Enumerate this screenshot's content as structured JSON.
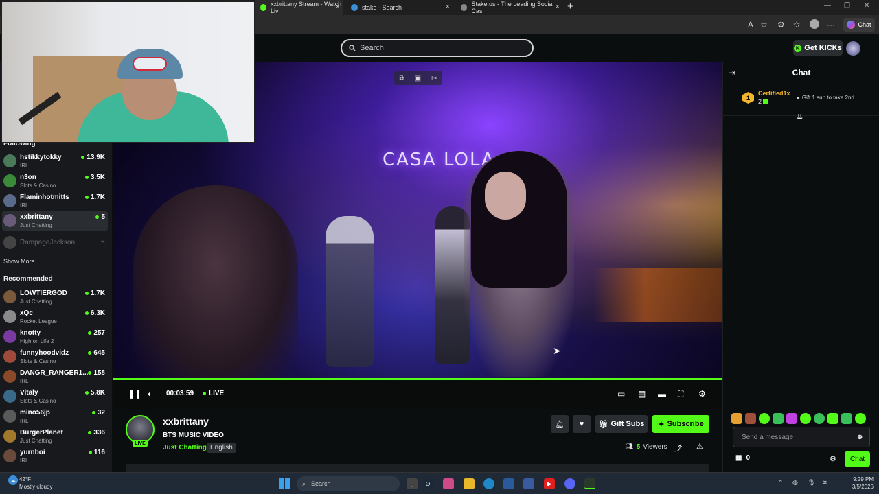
{
  "browser": {
    "tabs": [
      {
        "label": "xxbrittany Stream - Watch Liv"
      },
      {
        "label": "stake - Search"
      },
      {
        "label": "Stake.us - The Leading Social Casi"
      }
    ],
    "chat_button": "Chat"
  },
  "header": {
    "search_placeholder": "Search",
    "get_kicks": "Get KICKs"
  },
  "sidebar": {
    "following_heading": "Following",
    "following": [
      {
        "name": "hstikkytokky",
        "category": "IRL",
        "viewers": "13.9K",
        "color": "#4a7a5a"
      },
      {
        "name": "n3on",
        "category": "Slots & Casino",
        "viewers": "3.5K",
        "color": "#3a8a3a"
      },
      {
        "name": "Flaminhotmitts",
        "category": "IRL",
        "viewers": "1.7K",
        "color": "#5a6a8a"
      },
      {
        "name": "xxbrittany",
        "category": "Just Chatting",
        "viewers": "5",
        "color": "#6a5a7a"
      }
    ],
    "offline": {
      "name": "RampageJackson"
    },
    "show_more": "Show More",
    "recommended_heading": "Recommended",
    "recommended": [
      {
        "name": "LOWTIERGOD",
        "category": "Just Chatting",
        "viewers": "1.7K",
        "color": "#7a5a3a"
      },
      {
        "name": "xQc",
        "category": "Rocket League",
        "viewers": "6.3K",
        "color": "#8a8a8a"
      },
      {
        "name": "knotty",
        "category": "High on Life 2",
        "viewers": "257",
        "color": "#7a3aa0"
      },
      {
        "name": "funnyhoodvidz",
        "category": "Slots & Casino",
        "viewers": "645",
        "color": "#a04a3a"
      },
      {
        "name": "DANGR_RANGER1...",
        "category": "IRL",
        "viewers": "158",
        "color": "#8a4a2a"
      },
      {
        "name": "Vitaly",
        "category": "Slots & Casino",
        "viewers": "5.8K",
        "color": "#3a6a8a"
      },
      {
        "name": "mino56jp",
        "category": "IRL",
        "viewers": "32",
        "color": "#5a5a5a"
      },
      {
        "name": "BurgerPlanet",
        "category": "Just Chatting",
        "viewers": "336",
        "color": "#a07a2a"
      },
      {
        "name": "yurnboi",
        "category": "IRL",
        "viewers": "116",
        "color": "#6a4a3a"
      }
    ]
  },
  "video": {
    "sign_text": "CASA  LOLA"
  },
  "player": {
    "time": "00:03:59",
    "live": "LIVE",
    "progress": 1.0
  },
  "channel": {
    "name": "xxbrittany",
    "live_badge": "LIVE",
    "title": "BTS MUSIC VIDEO",
    "category": "Just Chatting",
    "language": "English",
    "gift_subs": "Gift Subs",
    "subscribe": "Subscribe",
    "viewers_count": "5",
    "viewers_label": "Viewers"
  },
  "chat": {
    "title": "Chat",
    "top_gifter": {
      "rank": "1",
      "name": "Certified1x",
      "count": "2"
    },
    "gift_tip": "Gift 1 sub to take 2nd",
    "input_placeholder": "Send a message",
    "kicks_balance": "0",
    "send_label": "Chat"
  },
  "taskbar": {
    "temperature": "42°F",
    "weather": "Mostly cloudy",
    "search": "Search",
    "time": "9:29 PM",
    "date": "3/5/2026"
  },
  "colors": {
    "brand_green": "#53fc18",
    "background": "#0b0e0f",
    "sidebar": "#17191c"
  }
}
